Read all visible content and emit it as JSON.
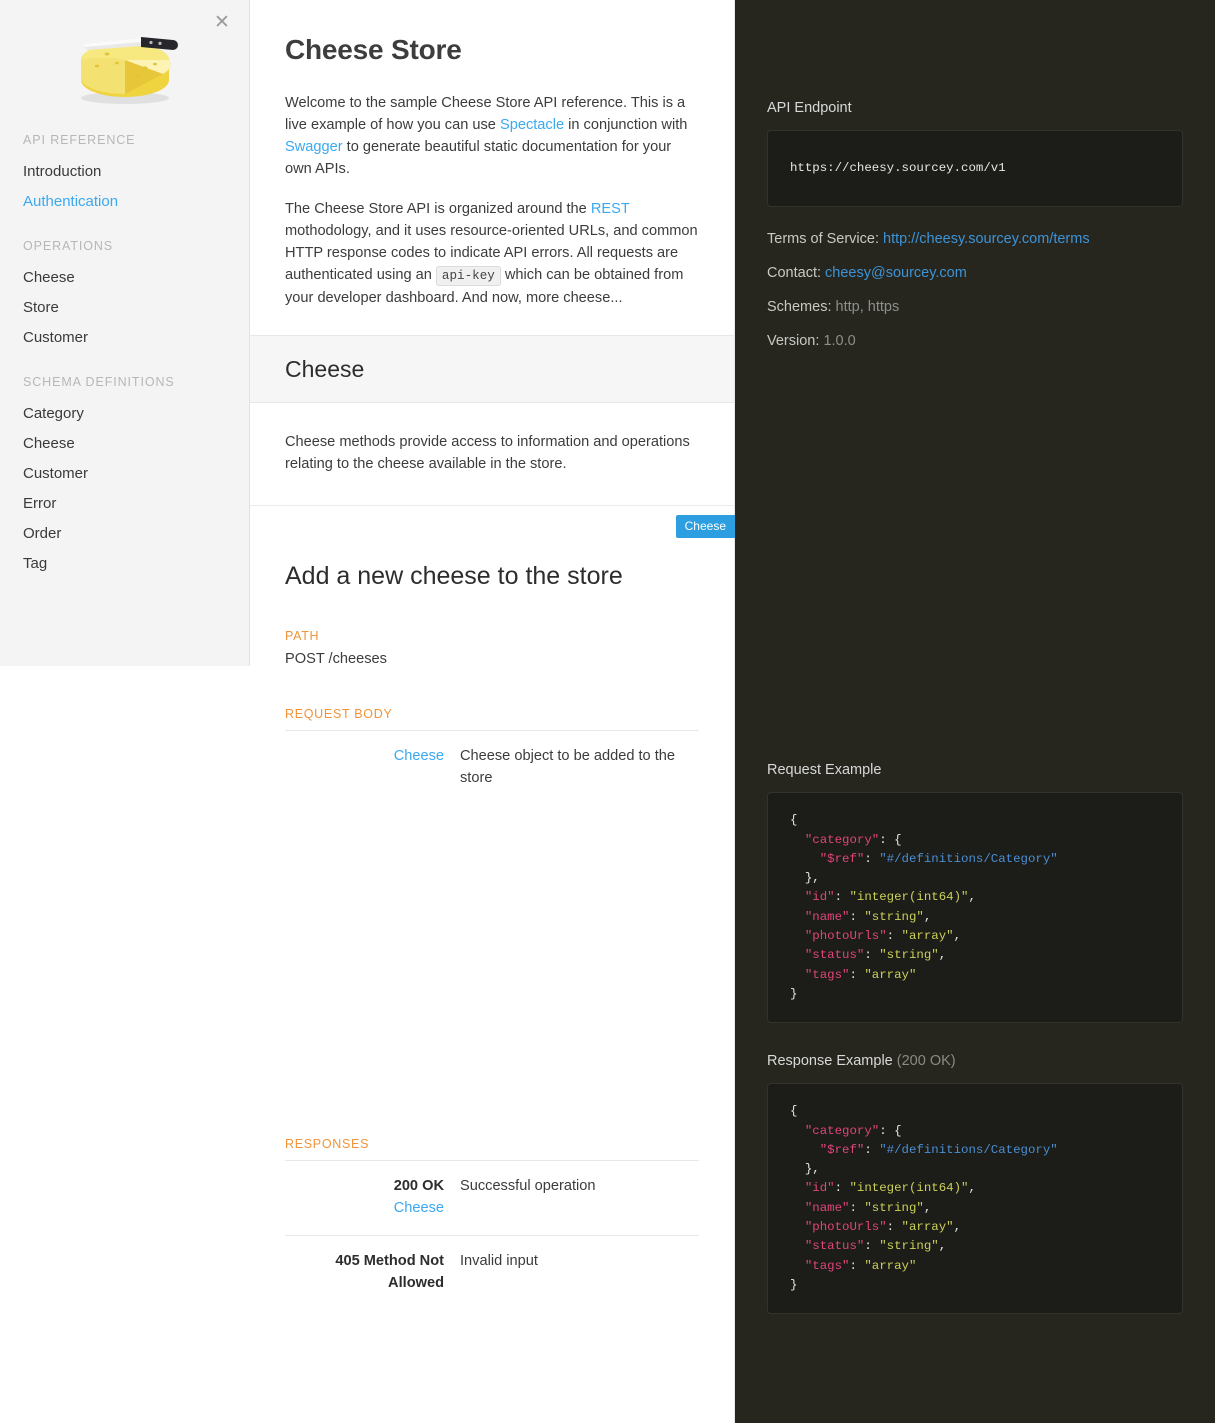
{
  "sidebar": {
    "close_icon": "close-icon",
    "logo_alt": "cheese-wheel-with-knife-logo",
    "groups": [
      {
        "heading": "API REFERENCE",
        "items": [
          {
            "label": "Introduction",
            "active": false
          },
          {
            "label": "Authentication",
            "active": true
          }
        ]
      },
      {
        "heading": "OPERATIONS",
        "items": [
          {
            "label": "Cheese",
            "active": false
          },
          {
            "label": "Store",
            "active": false
          },
          {
            "label": "Customer",
            "active": false
          }
        ]
      },
      {
        "heading": "SCHEMA DEFINITIONS",
        "items": [
          {
            "label": "Category",
            "active": false
          },
          {
            "label": "Cheese",
            "active": false
          },
          {
            "label": "Customer",
            "active": false
          },
          {
            "label": "Error",
            "active": false
          },
          {
            "label": "Order",
            "active": false
          },
          {
            "label": "Tag",
            "active": false
          }
        ]
      }
    ]
  },
  "doc": {
    "title": "Cheese Store",
    "intro_p1_a": "Welcome to the sample Cheese Store API reference. This is a live example of how you can use ",
    "intro_p1_link1": "Spectacle",
    "intro_p1_b": " in conjunction with ",
    "intro_p1_link2": "Swagger",
    "intro_p1_c": " to generate beautiful static documentation for your own APIs.",
    "intro_p2_a": "The Cheese Store API is organized around the ",
    "intro_p2_link": "REST",
    "intro_p2_b": " mothodology, and it uses resource-oriented URLs, and common HTTP response codes to indicate API errors. All requests are authenticated using an ",
    "intro_p2_code": "api-key",
    "intro_p2_c": " which can be obtained from your developer dashboard. And now, more cheese...",
    "group_title": "Cheese",
    "group_desc": "Cheese methods provide access to information and operations relating to the cheese available in the store.",
    "operation_tag": "Cheese",
    "operation_title": "Add a new cheese to the store",
    "path_label": "PATH",
    "path_value": "POST /cheeses",
    "request_body_label": "REQUEST BODY",
    "request_body_rows": [
      {
        "key": "Cheese",
        "key_is_link": true,
        "desc": "Cheese object to be added to the store"
      }
    ],
    "responses_label": "RESPONSES",
    "responses_rows": [
      {
        "code": "200 OK",
        "ref": "Cheese",
        "desc": "Successful operation"
      },
      {
        "code": "405 Method Not Allowed",
        "ref": "",
        "desc": "Invalid input"
      }
    ]
  },
  "panel": {
    "endpoint_label": "API Endpoint",
    "endpoint_url": "https://cheesy.sourcey.com/v1",
    "terms_label": "Terms of Service:",
    "terms_value": "http://cheesy.sourcey.com/terms",
    "contact_label": "Contact:",
    "contact_value": "cheesy@sourcey.com",
    "schemes_label": "Schemes:",
    "schemes_value": "http, https",
    "version_label": "Version:",
    "version_value": "1.0.0",
    "request_example_label": "Request Example",
    "response_example_label": "Response Example",
    "response_example_status": "(200 OK)",
    "example_json": {
      "lines": [
        {
          "indent": 0,
          "tokens": [
            {
              "c": "punct",
              "t": "{"
            }
          ]
        },
        {
          "indent": 1,
          "tokens": [
            {
              "c": "key",
              "t": "\"category\""
            },
            {
              "c": "punct",
              "t": ": {"
            }
          ]
        },
        {
          "indent": 2,
          "tokens": [
            {
              "c": "key",
              "t": "\"$ref\""
            },
            {
              "c": "punct",
              "t": ": "
            },
            {
              "c": "ref",
              "t": "\"#/definitions/Category\""
            }
          ]
        },
        {
          "indent": 1,
          "tokens": [
            {
              "c": "punct",
              "t": "},"
            }
          ]
        },
        {
          "indent": 1,
          "tokens": [
            {
              "c": "key",
              "t": "\"id\""
            },
            {
              "c": "punct",
              "t": ": "
            },
            {
              "c": "str",
              "t": "\"integer(int64)\""
            },
            {
              "c": "punct",
              "t": ","
            }
          ]
        },
        {
          "indent": 1,
          "tokens": [
            {
              "c": "key",
              "t": "\"name\""
            },
            {
              "c": "punct",
              "t": ": "
            },
            {
              "c": "str",
              "t": "\"string\""
            },
            {
              "c": "punct",
              "t": ","
            }
          ]
        },
        {
          "indent": 1,
          "tokens": [
            {
              "c": "key",
              "t": "\"photoUrls\""
            },
            {
              "c": "punct",
              "t": ": "
            },
            {
              "c": "str",
              "t": "\"array\""
            },
            {
              "c": "punct",
              "t": ","
            }
          ]
        },
        {
          "indent": 1,
          "tokens": [
            {
              "c": "key",
              "t": "\"status\""
            },
            {
              "c": "punct",
              "t": ": "
            },
            {
              "c": "str",
              "t": "\"string\""
            },
            {
              "c": "punct",
              "t": ","
            }
          ]
        },
        {
          "indent": 1,
          "tokens": [
            {
              "c": "key",
              "t": "\"tags\""
            },
            {
              "c": "punct",
              "t": ": "
            },
            {
              "c": "str",
              "t": "\"array\""
            }
          ]
        },
        {
          "indent": 0,
          "tokens": [
            {
              "c": "punct",
              "t": "}"
            }
          ]
        }
      ]
    }
  },
  "colors": {
    "accent_blue": "#3ba9f0",
    "tag_blue": "#2d9ee0",
    "label_orange": "#f29339",
    "panel_dark": "#26261f",
    "code_dark": "#1c1c18"
  }
}
